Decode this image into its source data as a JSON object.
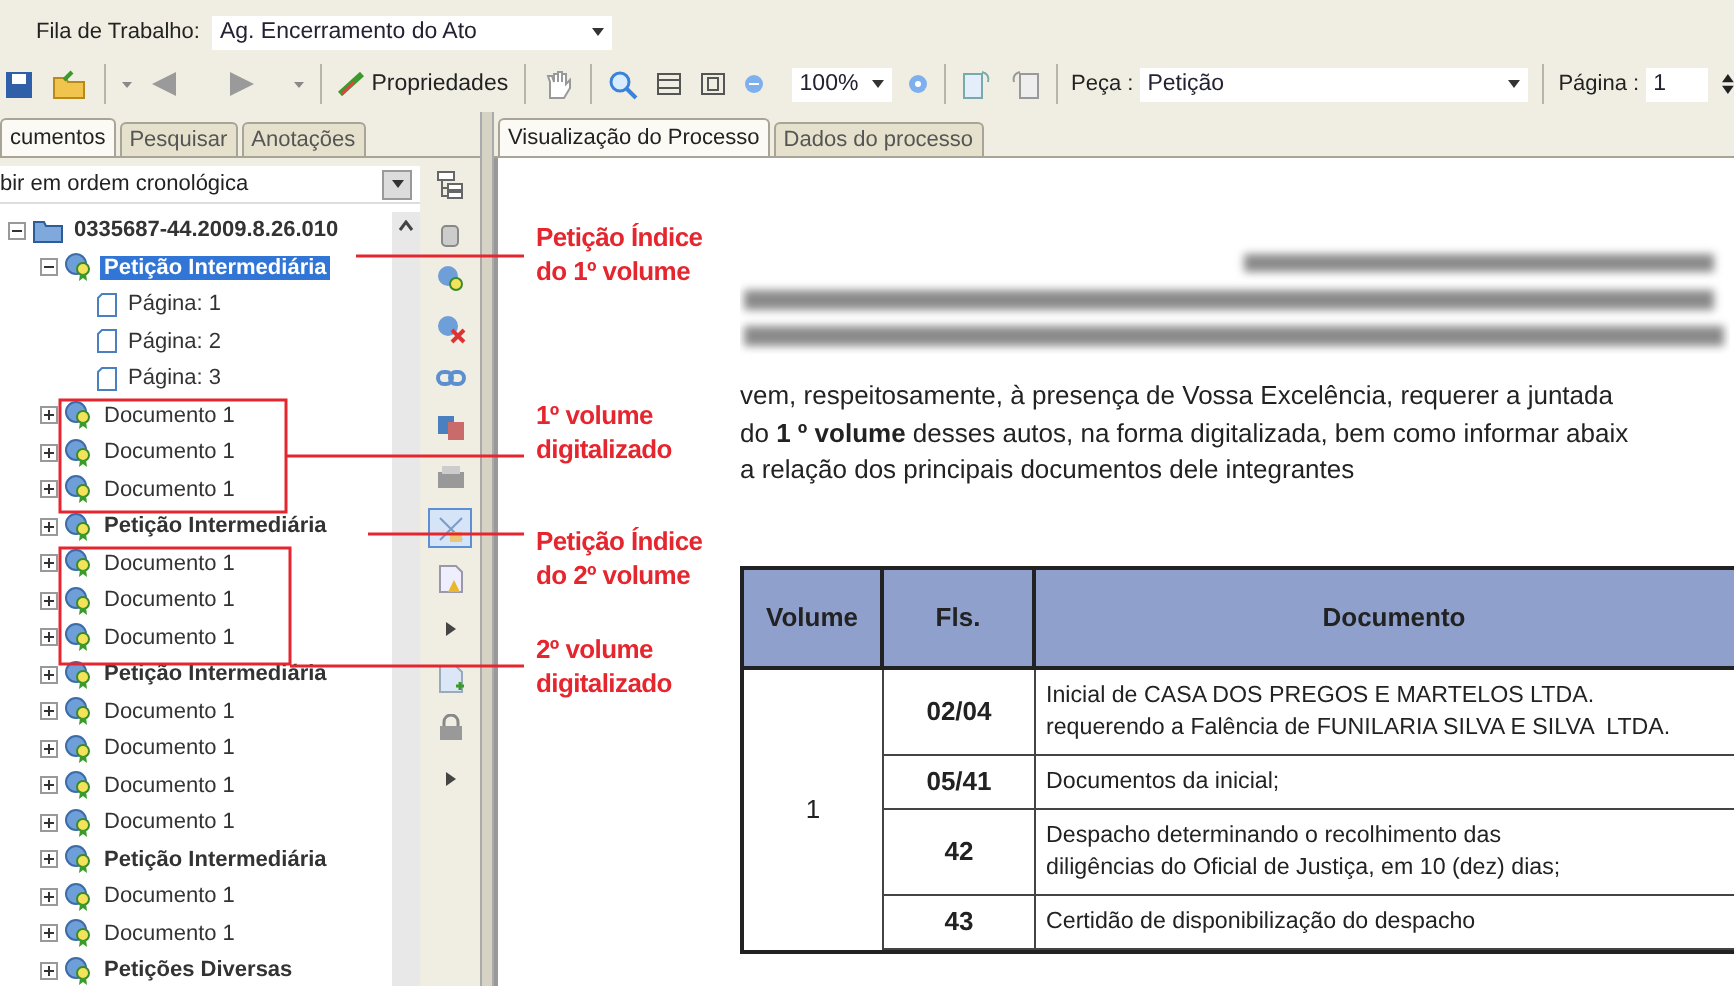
{
  "queue": {
    "label": "Fila de Trabalho:",
    "value": "Ag. Encerramento do Ato"
  },
  "toolbar": {
    "properties_button": "Propriedades",
    "zoom": "100%",
    "piece_label": "Peça :",
    "piece_value": "Petição",
    "page_label": "Página :",
    "page_value": "1"
  },
  "left_tabs": [
    {
      "label": "cumentos",
      "selected": true
    },
    {
      "label": "Pesquisar",
      "selected": false
    },
    {
      "label": "Anotações",
      "selected": false
    }
  ],
  "order_select": {
    "value": "bir em ordem cronológica"
  },
  "tree": [
    {
      "label": "0335687-44.2009.8.26.010",
      "kind": "process",
      "expanded": true,
      "selected": false,
      "children": [
        {
          "label": "Petição Intermediária",
          "kind": "petition",
          "expanded": true,
          "selected": true,
          "children": [
            {
              "label": "Página: 1",
              "kind": "page",
              "selected": false
            },
            {
              "label": "Página: 2",
              "kind": "page",
              "selected": false
            },
            {
              "label": "Página: 3",
              "kind": "page",
              "selected": false
            }
          ]
        },
        {
          "label": "Documento 1",
          "kind": "document",
          "expanded": false,
          "selected": false
        },
        {
          "label": "Documento 1",
          "kind": "document",
          "expanded": false,
          "selected": false
        },
        {
          "label": "Documento 1",
          "kind": "document",
          "expanded": false,
          "selected": false
        },
        {
          "label": "Petição Intermediária",
          "kind": "petition",
          "expanded": false,
          "selected": false
        },
        {
          "label": "Documento 1",
          "kind": "document",
          "expanded": false,
          "selected": false
        },
        {
          "label": "Documento 1",
          "kind": "document",
          "expanded": false,
          "selected": false
        },
        {
          "label": "Documento 1",
          "kind": "document",
          "expanded": false,
          "selected": false
        },
        {
          "label": "Petição Intermediária",
          "kind": "petition",
          "expanded": false,
          "selected": false
        },
        {
          "label": "Documento 1",
          "kind": "document",
          "expanded": false,
          "selected": false
        },
        {
          "label": "Documento 1",
          "kind": "document",
          "expanded": false,
          "selected": false
        },
        {
          "label": "Documento 1",
          "kind": "document",
          "expanded": false,
          "selected": false
        },
        {
          "label": "Documento 1",
          "kind": "document",
          "expanded": false,
          "selected": false
        },
        {
          "label": "Petição Intermediária",
          "kind": "petition",
          "expanded": false,
          "selected": false
        },
        {
          "label": "Documento 1",
          "kind": "document",
          "expanded": false,
          "selected": false
        },
        {
          "label": "Documento 1",
          "kind": "document",
          "expanded": false,
          "selected": false
        },
        {
          "label": "Petições Diversas",
          "kind": "petition",
          "expanded": false,
          "selected": false
        }
      ]
    }
  ],
  "side_tools": [
    {
      "kind": "seal-add",
      "selected": false
    },
    {
      "kind": "seal-remove",
      "selected": false
    },
    {
      "kind": "link",
      "selected": false
    },
    {
      "kind": "copy",
      "selected": false
    },
    {
      "kind": "printer",
      "selected": false
    },
    {
      "kind": "split",
      "selected": true
    },
    {
      "kind": "warning-page",
      "selected": false
    },
    {
      "kind": "arrow",
      "selected": false
    },
    {
      "kind": "add-page",
      "selected": false
    },
    {
      "kind": "lock",
      "selected": false
    },
    {
      "kind": "arrow",
      "selected": false
    }
  ],
  "right_tabs": [
    {
      "label": "Visualização do Processo",
      "selected": true
    },
    {
      "label": "Dados do processo",
      "selected": false
    }
  ],
  "document": {
    "paragraph": "vem, respeitosamente, à presença de Vossa Excelência, requerer a juntada\ndo **1 º volume** desses autos, na forma digitalizada, bem como informar abaix\na relação dos principais documentos dele integrantes",
    "table": {
      "columns": [
        "Volume",
        "Fls.",
        "Documento"
      ],
      "volume": "1",
      "rows": [
        {
          "fls": "02/04",
          "documento": "Inicial de CASA DOS PREGOS E MARTELOS LTDA.\nrequerendo a Falência de FUNILARIA SILVA E SILVA  LTDA."
        },
        {
          "fls": "05/41",
          "documento": "Documentos da inicial;"
        },
        {
          "fls": "42",
          "documento": "Despacho determinando o recolhimento das\ndiligências do Oficial de Justiça, em 10 (dez) dias;"
        },
        {
          "fls": "43",
          "documento": "Certidão de disponibilização do despacho"
        }
      ]
    }
  },
  "annotations": [
    {
      "text": "Petição Índice\ndo 1º volume"
    },
    {
      "text": "1º volume\ndigitalizado"
    },
    {
      "text": "Petição Índice\ndo 2º volume"
    },
    {
      "text": "2º volume\ndigitalizado"
    }
  ]
}
